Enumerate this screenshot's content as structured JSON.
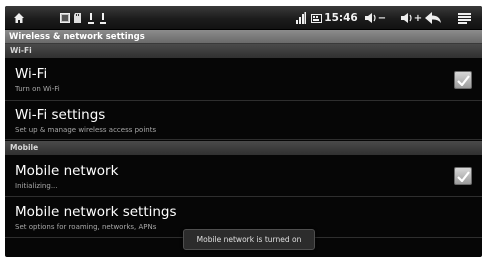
{
  "status_bar": {
    "time": "15:46",
    "volume_down_label": "−",
    "volume_up_label": "+",
    "icons": [
      "home-icon",
      "gallery-notification-icon",
      "sd-card-icon",
      "warning-icon",
      "warning-icon",
      "sim-card-icon",
      "keyboard-icon",
      "volume-down-icon",
      "volume-up-icon",
      "back-icon",
      "menu-icon"
    ]
  },
  "title": "Wireless & network settings",
  "sections": {
    "wifi_header": "Wi-Fi",
    "mobile_header": "Mobile"
  },
  "rows": {
    "wifi": {
      "title": "Wi-Fi",
      "subtitle": "Turn on Wi-Fi",
      "checked": true
    },
    "wifi_settings": {
      "title": "Wi-Fi settings",
      "subtitle": "Set up & manage wireless access points"
    },
    "mobile_network": {
      "title": "Mobile network",
      "subtitle": "Initializing...",
      "checked": true
    },
    "mobile_network_settings": {
      "title": "Mobile network settings",
      "subtitle": "Set options for roaming, networks, APNs"
    }
  },
  "toast": "Mobile network is turned on",
  "colors": {
    "background": "#060606",
    "title_bar": "#7a7a7a",
    "section_header": "#3c3c3c",
    "checkbox": "#bdbdbd",
    "check_mark": "#ffffff"
  }
}
